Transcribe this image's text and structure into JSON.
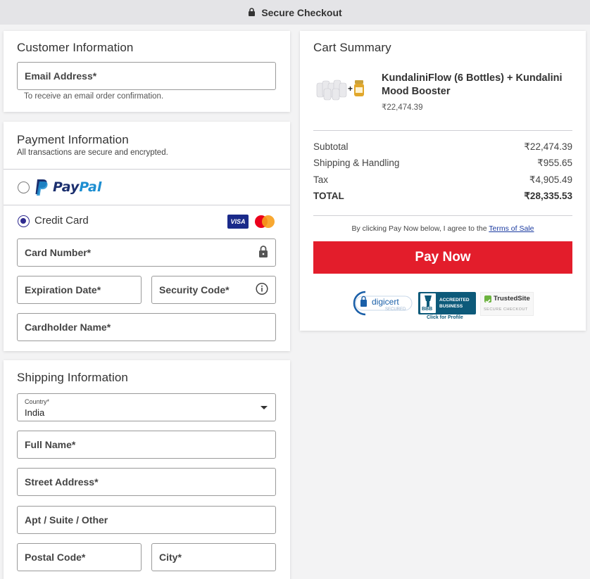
{
  "header": {
    "title": "Secure Checkout",
    "icon": "lock-icon"
  },
  "customer": {
    "title": "Customer Information",
    "email_placeholder": "Email Address*",
    "email_hint": "To receive an email order confirmation."
  },
  "payment": {
    "title": "Payment Information",
    "subtitle": "All transactions are secure and encrypted.",
    "paypal_left": "Pay",
    "paypal_right": "Pal",
    "credit_label": "Credit Card",
    "visa": "VISA",
    "card_number": "Card Number*",
    "expiration": "Expiration Date*",
    "security_code": "Security Code*",
    "cardholder": "Cardholder Name*",
    "selected_method": "credit-card"
  },
  "shipping": {
    "title": "Shipping Information",
    "country_label": "Country*",
    "country_value": "India",
    "full_name": "Full Name*",
    "street": "Street Address*",
    "apt": "Apt / Suite / Other",
    "postal": "Postal Code*",
    "city": "City*"
  },
  "cart": {
    "title": "Cart Summary",
    "product_line1": "KundaliniFlow (6 Bottles) + Kundalini",
    "product_line2": "Mood Booster",
    "product_price": "₹22,474.39",
    "subtotal_label": "Subtotal",
    "subtotal_value": "₹22,474.39",
    "shipping_label": "Shipping & Handling",
    "shipping_value": "₹955.65",
    "tax_label": "Tax",
    "tax_value": "₹4,905.49",
    "total_label": "TOTAL",
    "total_value": "₹28,335.53",
    "terms_prefix": "By clicking Pay Now below, I agree to the ",
    "terms_link": "Terms of Sale",
    "pay_button": "Pay Now"
  },
  "trust": {
    "digicert": "digicert",
    "digicert_sub": "SECURED",
    "bbb_line1": "ACCREDITED",
    "bbb_line2": "BUSINESS",
    "bbb_click": "Click for Profile",
    "bbb_logo": "BBB",
    "trusted_name": "TrustedSite",
    "trusted_sub": "SECURE CHECKOUT"
  },
  "colors": {
    "accent": "#e31d2b",
    "radio": "#2e2a8f",
    "link": "#1a3aa0"
  }
}
